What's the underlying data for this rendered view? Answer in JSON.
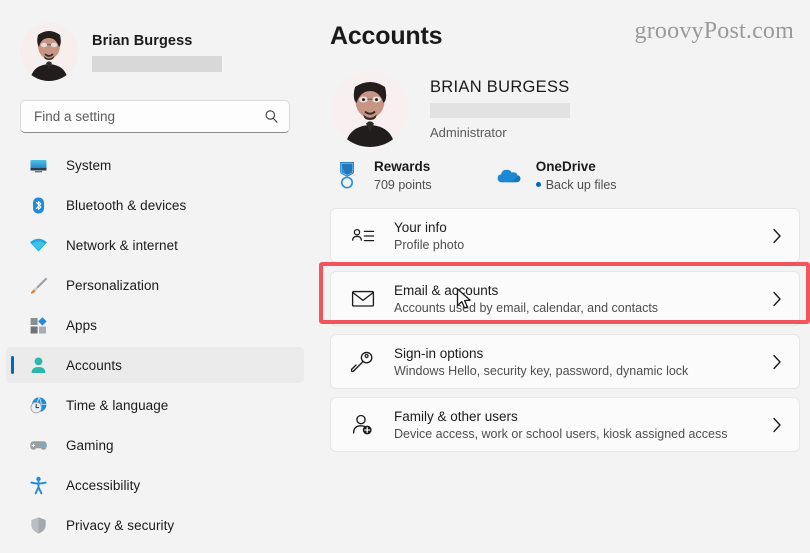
{
  "sidebar": {
    "profile": {
      "name": "Brian Burgess",
      "email_redacted": "",
      "avatar_alt": "user-avatar"
    },
    "search": {
      "placeholder": "Find a setting",
      "value": "",
      "icon": "search-icon"
    },
    "items": [
      {
        "label": "System",
        "icon": "monitor-icon",
        "selected": false
      },
      {
        "label": "Bluetooth & devices",
        "icon": "bluetooth-icon",
        "selected": false
      },
      {
        "label": "Network & internet",
        "icon": "wifi-icon",
        "selected": false
      },
      {
        "label": "Personalization",
        "icon": "paintbrush-icon",
        "selected": false
      },
      {
        "label": "Apps",
        "icon": "apps-grid-icon",
        "selected": false
      },
      {
        "label": "Accounts",
        "icon": "person-icon",
        "selected": true
      },
      {
        "label": "Time & language",
        "icon": "globe-clock-icon",
        "selected": false
      },
      {
        "label": "Gaming",
        "icon": "game-controller-icon",
        "selected": false
      },
      {
        "label": "Accessibility",
        "icon": "accessibility-person-icon",
        "selected": false
      },
      {
        "label": "Privacy & security",
        "icon": "shield-icon",
        "selected": false
      }
    ]
  },
  "main": {
    "title": "Accounts",
    "watermark": "groovyPost.com",
    "user": {
      "name": "BRIAN BURGESS",
      "email_redacted": "",
      "role": "Administrator"
    },
    "services": [
      {
        "title": "Rewards",
        "sub": "709 points",
        "icon": "rewards-medal-icon"
      },
      {
        "title": "OneDrive",
        "sub": "Back up files",
        "icon": "onedrive-cloud-icon",
        "has_dot": true
      }
    ],
    "cards": [
      {
        "title": "Your info",
        "sub": "Profile photo",
        "icon": "contact-card-icon",
        "chevron": "›",
        "highlighted": true
      },
      {
        "title": "Email & accounts",
        "sub": "Accounts used by email, calendar, and contacts",
        "icon": "envelope-icon",
        "chevron": "›",
        "highlighted": false
      },
      {
        "title": "Sign-in options",
        "sub": "Windows Hello, security key, password, dynamic lock",
        "icon": "key-icon",
        "chevron": "›",
        "highlighted": false
      },
      {
        "title": "Family & other users",
        "sub": "Device access, work or school users, kiosk assigned access",
        "icon": "add-user-icon",
        "chevron": "›",
        "highlighted": false
      }
    ]
  },
  "annotation": {
    "highlight_color": "#f2545b",
    "accent_color": "#0067c0",
    "cursor": "arrow-pointer"
  }
}
